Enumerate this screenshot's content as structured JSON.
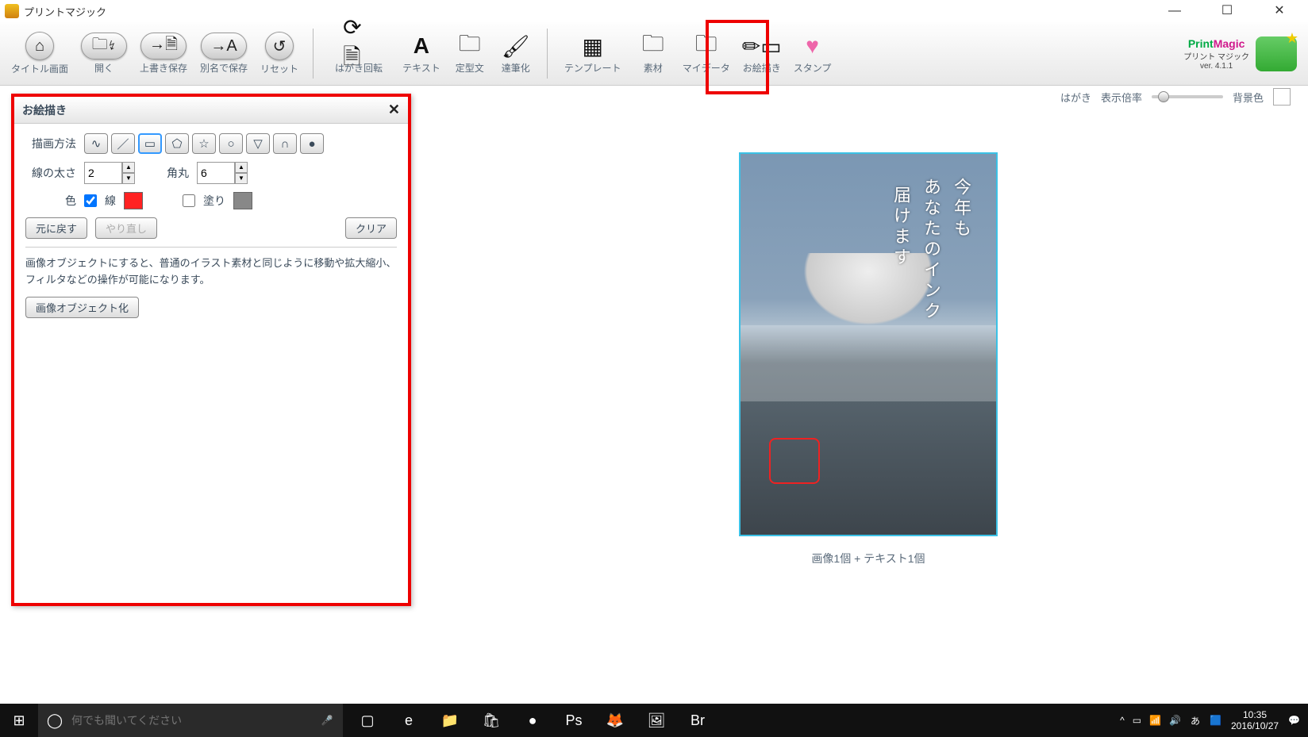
{
  "window": {
    "title": "プリントマジック",
    "minimize": "—",
    "maximize": "☐",
    "close": "✕"
  },
  "toolbar": {
    "title_screen": "タイトル画面",
    "open": "開く",
    "overwrite_save": "上書き保存",
    "save_as": "別名で保存",
    "reset": "リセット",
    "postcard_rotate": "はがき回転",
    "text": "テキスト",
    "fixed_phrase": "定型文",
    "brush": "達筆化",
    "template": "テンプレート",
    "material": "素材",
    "my_data": "マイデータ",
    "drawing": "お絵描き",
    "stamp": "スタンプ"
  },
  "brand": {
    "name_print": "Print",
    "name_magic": "Magic",
    "sub": "プリント マジック",
    "version": "ver. 4.1.1"
  },
  "canvas_strip": {
    "postcard": "はがき",
    "zoom_label": "表示倍率",
    "bg_label": "背景色"
  },
  "panel": {
    "title": "お絵描き",
    "method_label": "描画方法",
    "thickness_label": "線の太さ",
    "thickness_value": "2",
    "corner_label": "角丸",
    "corner_value": "6",
    "color_label": "色",
    "line_label": "線",
    "fill_label": "塗り",
    "undo": "元に戻す",
    "redo": "やり直し",
    "clear": "クリア",
    "help_text": "画像オブジェクトにすると、普通のイラスト素材と同じように移動や拡大縮小、フィルタなどの操作が可能になります。",
    "make_object": "画像オブジェクト化",
    "shapes": [
      "∿",
      "／",
      "▭",
      "⬠",
      "☆",
      "○",
      "▽",
      "∩",
      "●"
    ],
    "selected_shape_index": 2,
    "line_checked": true,
    "fill_checked": false,
    "line_color": "#f22",
    "fill_color": "#888"
  },
  "postcard_text": {
    "col1": "今年も",
    "col2": "あなたのインク",
    "col3": "届けます"
  },
  "status": "画像1個 + テキスト1個",
  "taskbar": {
    "search_placeholder": "何でも聞いてください",
    "ime": "あ",
    "time": "10:35",
    "date": "2016/10/27",
    "apps": [
      "▢",
      "e",
      "📁",
      "🛍",
      "●",
      "Ps",
      "🦊",
      "🖼",
      "Br"
    ],
    "tray": [
      "^",
      "▭",
      "📶",
      "🔊"
    ]
  }
}
